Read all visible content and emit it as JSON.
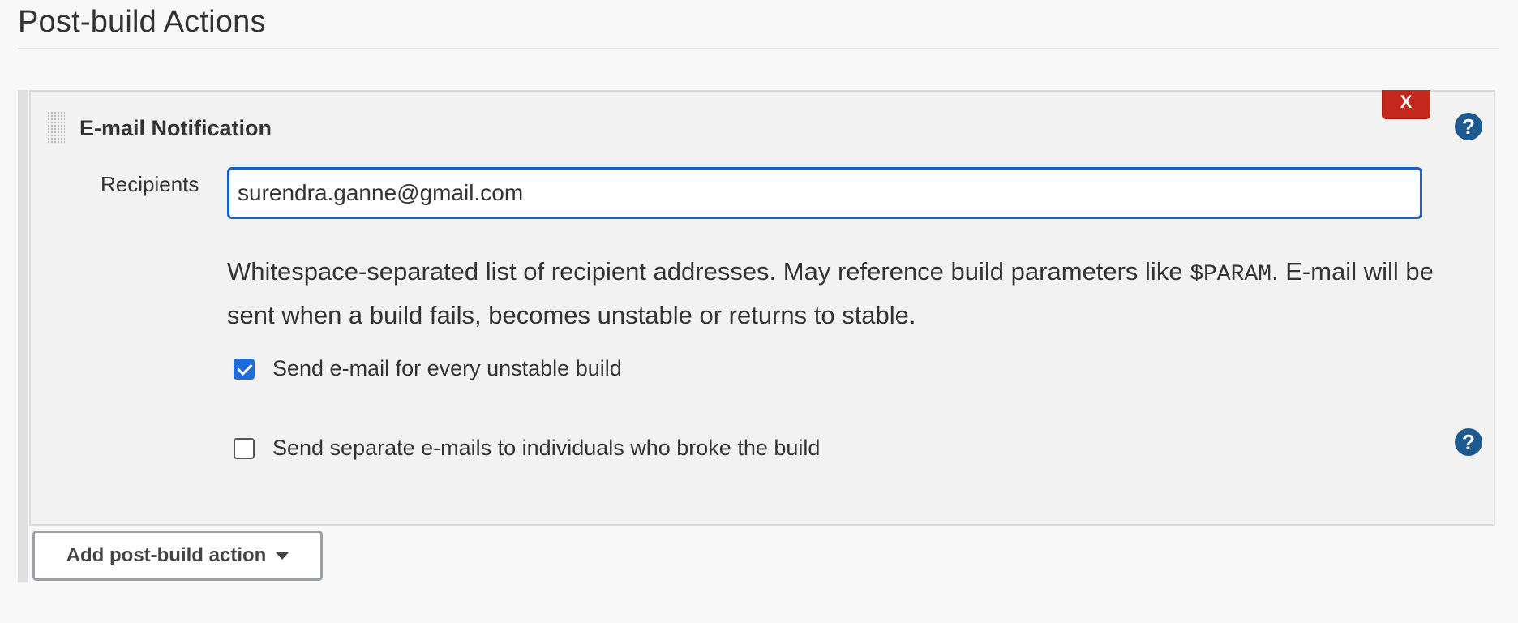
{
  "section": {
    "title": "Post-build Actions"
  },
  "email_notification": {
    "title": "E-mail Notification",
    "delete_label": "X",
    "help_symbol": "?",
    "recipients_label": "Recipients",
    "recipients_value": "surendra.ganne@gmail.com",
    "help_text_before": "Whitespace-separated list of recipient addresses. May reference build parameters like ",
    "help_text_code": "$PARAM",
    "help_text_after": ". E-mail will be sent when a build fails, becomes unstable or returns to stable.",
    "options": [
      {
        "label": "Send e-mail for every unstable build",
        "checked": true
      },
      {
        "label": "Send separate e-mails to individuals who broke the build",
        "checked": false
      }
    ]
  },
  "add_action": {
    "label": "Add post-build action"
  },
  "colors": {
    "delete_button": "#c4271c",
    "help_icon": "#1d5a8f",
    "input_focus_border": "#1c5fc4",
    "checkbox_checked": "#1c6dd8"
  },
  "icons": {
    "drag_handle": "drag-handle-icon",
    "help": "help-icon",
    "dropdown": "caret-down-icon"
  }
}
